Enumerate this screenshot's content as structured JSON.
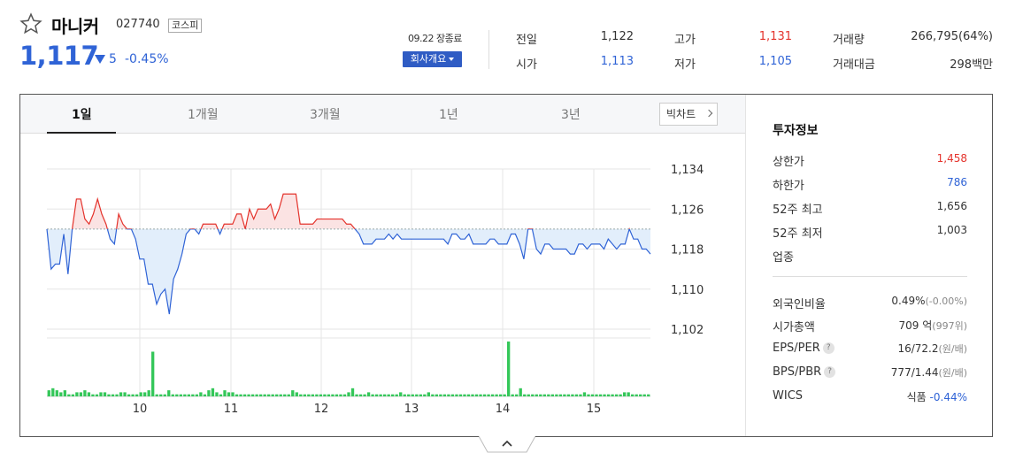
{
  "stock": {
    "name": "마니커",
    "code": "027740",
    "market": "코스피",
    "price": "1,117",
    "change": "5",
    "change_pct": "-0.45%",
    "status_date": "09.22 장종료",
    "company_button": "회사개요"
  },
  "quote": {
    "prev_close_label": "전일",
    "prev_close": "1,122",
    "open_label": "시가",
    "open": "1,113",
    "high_label": "고가",
    "high": "1,131",
    "low_label": "저가",
    "low": "1,105",
    "volume_label": "거래량",
    "volume": "266,795(64%)",
    "amount_label": "거래대금",
    "amount": "298백만"
  },
  "tabs": [
    "1일",
    "1개월",
    "3개월",
    "1년",
    "3년"
  ],
  "active_tab": "1일",
  "big_chart_label": "빅차트",
  "info": {
    "title": "투자정보",
    "rows": [
      {
        "label": "상한가",
        "value": "1,458"
      },
      {
        "label": "하한가",
        "value": "786"
      },
      {
        "label": "52주 최고",
        "value": "1,656"
      },
      {
        "label": "52주 최저",
        "value": "1,003"
      },
      {
        "label": "업종",
        "value": ""
      }
    ],
    "rows2": [
      {
        "label": "외국인비율",
        "value": "0.49%",
        "sub": "(-0.00%)"
      },
      {
        "label": "시가총액",
        "value": "709 억",
        "sub": "(997위)"
      },
      {
        "label": "EPS/PER",
        "value": "16/72.2",
        "sub": "(원/배)",
        "help": "?"
      },
      {
        "label": "BPS/PBR",
        "value": "777/1.44",
        "sub": "(원/배)",
        "help": "?"
      },
      {
        "label": "WICS",
        "value": "식품",
        "sub": "-0.44%"
      }
    ]
  },
  "colors": {
    "up": "#e4322b",
    "down": "#2f63d6",
    "volume": "#34c759",
    "up_fill": "#fbe3e3",
    "down_fill": "#e2eefb"
  },
  "chart_data": {
    "type": "line",
    "x_ticks": [
      "10",
      "11",
      "12",
      "13",
      "14",
      "15"
    ],
    "y_ticks": [
      1134,
      1126,
      1118,
      1110,
      1102
    ],
    "ylim": [
      1102,
      1134
    ],
    "baseline": 1122,
    "price": [
      1122,
      1114,
      1115,
      1115,
      1121,
      1113,
      1122,
      1128,
      1128,
      1124,
      1123,
      1125,
      1128,
      1125,
      1123,
      1120,
      1119,
      1125,
      1123,
      1122,
      1122,
      1120,
      1116,
      1116,
      1111,
      1111,
      1107,
      1109,
      1110,
      1105,
      1112,
      1114,
      1117,
      1121,
      1122,
      1122,
      1121,
      1123,
      1123,
      1123,
      1123,
      1121,
      1123,
      1123,
      1123,
      1125,
      1125,
      1122,
      1126,
      1124,
      1126,
      1126,
      1126,
      1127,
      1124,
      1126,
      1129,
      1129,
      1129,
      1129,
      1123,
      1123,
      1123,
      1123,
      1124,
      1124,
      1124,
      1124,
      1124,
      1124,
      1124,
      1123,
      1123,
      1122,
      1121,
      1119,
      1119,
      1119,
      1120,
      1120,
      1120,
      1121,
      1120,
      1121,
      1120,
      1120,
      1120,
      1120,
      1120,
      1120,
      1120,
      1120,
      1120,
      1120,
      1120,
      1119,
      1121,
      1121,
      1120,
      1120,
      1121,
      1119,
      1119,
      1119,
      1119,
      1120,
      1120,
      1119,
      1119,
      1119,
      1121,
      1121,
      1119,
      1116,
      1122,
      1122,
      1118,
      1117,
      1119,
      1119,
      1118,
      1118,
      1118,
      1118,
      1117,
      1117,
      1119,
      1119,
      1118,
      1119,
      1119,
      1119,
      1118,
      1120,
      1119,
      1118,
      1119,
      1119,
      1122,
      1120,
      1120,
      1118,
      1118,
      1117
    ],
    "volume": [
      3,
      4,
      3,
      2,
      3,
      1,
      1,
      2,
      2,
      3,
      2,
      1,
      1,
      2,
      2,
      1,
      1,
      1,
      2,
      2,
      1,
      1,
      1,
      2,
      2,
      3,
      22,
      1,
      1,
      1,
      3,
      1,
      1,
      1,
      1,
      1,
      1,
      1,
      2,
      1,
      3,
      4,
      2,
      1,
      3,
      2,
      2,
      1,
      1,
      1,
      1,
      1,
      1,
      1,
      1,
      1,
      1,
      1,
      1,
      1,
      1,
      3,
      2,
      1,
      1,
      1,
      1,
      1,
      1,
      1,
      1,
      1,
      1,
      1,
      1,
      2,
      4,
      1,
      1,
      1,
      2,
      1,
      1,
      1,
      1,
      1,
      1,
      1,
      2,
      1,
      1,
      1,
      1,
      1,
      1,
      2,
      1,
      1,
      1,
      1,
      1,
      1,
      1,
      1,
      1,
      1,
      1,
      1,
      1,
      1,
      1,
      1,
      1,
      1,
      1,
      27,
      1,
      1,
      4,
      1,
      1,
      1,
      1,
      1,
      1,
      1,
      1,
      1,
      1,
      1,
      1,
      1,
      1,
      1,
      2,
      1,
      1,
      1,
      1,
      1,
      1,
      1,
      1,
      1,
      2,
      2,
      1,
      1,
      1,
      1,
      1
    ]
  }
}
